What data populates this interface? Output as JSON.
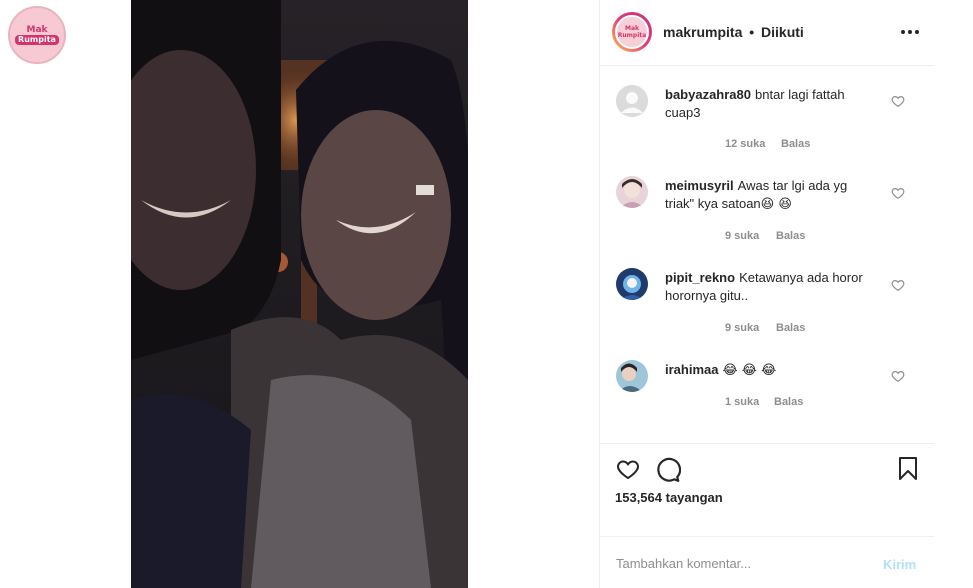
{
  "left_logo": {
    "line1": "Mak",
    "line2": "Rumpita"
  },
  "header": {
    "username": "makrumpita",
    "separator": "•",
    "follow_status": "Diikuti",
    "avatar_line1": "Mak",
    "avatar_line2": "Rumpita"
  },
  "comments": [
    {
      "username": "babyazahra80",
      "text": "bntar lagi fattah cuap3",
      "likes": "12 suka",
      "reply": "Balas",
      "avatar": "default-avatar-icon"
    },
    {
      "username": "meimusyril",
      "text": "Awas tar lgi ada yg triak\" kya satoan",
      "emoji": "😆 😆",
      "likes": "9 suka",
      "reply": "Balas",
      "avatar": "user-photo"
    },
    {
      "username": "pipit_rekno",
      "text": "Ketawanya ada horor horornya gitu..",
      "likes": "9 suka",
      "reply": "Balas",
      "avatar": "user-photo"
    },
    {
      "username": "irahimaa",
      "text": "",
      "emoji": "😂 😂 😂",
      "likes": "1 suka",
      "reply": "Balas",
      "avatar": "user-photo"
    }
  ],
  "actions": {
    "views_count": "153,564",
    "views_label": "tayangan"
  },
  "add_comment": {
    "placeholder": "Tambahkan komentar...",
    "post_label": "Kirim"
  },
  "colors": {
    "text": "#262626",
    "muted": "#8e8e8e",
    "border": "#efefef",
    "post_disabled": "#b2dffc",
    "brand_pink": "#d6336c"
  }
}
